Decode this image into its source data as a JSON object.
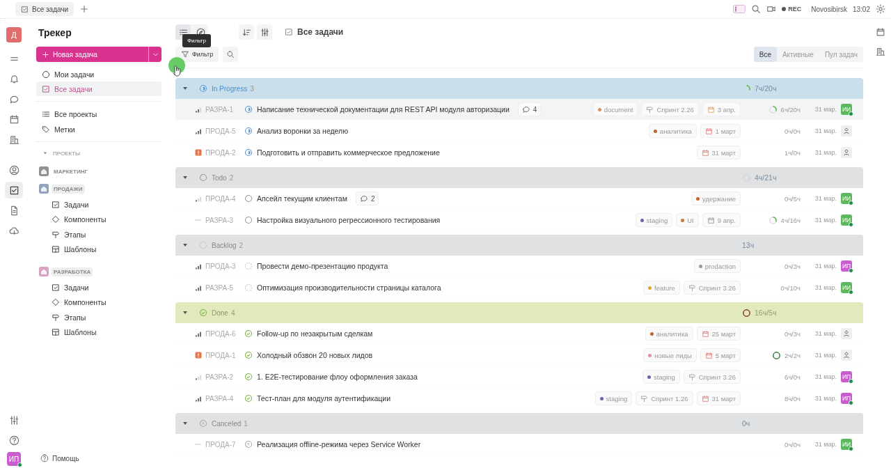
{
  "tab_bar": {
    "tabs": [
      {
        "label": "Все задачи",
        "selected": true
      }
    ],
    "rec": "REC",
    "city": "Novosibirsk",
    "time": "13:02"
  },
  "rail": {
    "logo": "Д",
    "items": [
      {
        "kind": "menu",
        "selected": false
      },
      {
        "kind": "bell",
        "selected": false
      },
      {
        "kind": "chat",
        "selected": false
      },
      {
        "kind": "calendar",
        "selected": false
      },
      {
        "kind": "building",
        "selected": false
      },
      {
        "kind": "user",
        "selected": false
      },
      {
        "kind": "tasks",
        "selected": true
      },
      {
        "kind": "document",
        "selected": false
      },
      {
        "kind": "cloud",
        "selected": false
      }
    ],
    "user": "ИП"
  },
  "sidebar": {
    "title": "Трекер",
    "new_button": "Новая задача",
    "nav": [
      {
        "label": "Мои задачи",
        "kind": "my",
        "selected": false
      },
      {
        "label": "Все задачи",
        "kind": "tasks",
        "selected": true
      }
    ],
    "links": [
      {
        "label": "Все проекты",
        "kind": "list"
      },
      {
        "label": "Метки",
        "kind": "tag"
      }
    ],
    "section": {
      "label": "ПРОЕКТЫ",
      "expanded": true
    },
    "projects": [
      {
        "name": "МАРКЕТИНГ",
        "color": "#8e9196",
        "expanded": false
      },
      {
        "name": "ПРОДАЖИ",
        "color": "#8fa3bd",
        "expanded": true,
        "children": [
          {
            "label": "Задачи",
            "kind": "tasks"
          },
          {
            "label": "Компоненты",
            "kind": "diamond"
          },
          {
            "label": "Этапы",
            "kind": "signpost"
          },
          {
            "label": "Шаблоны",
            "kind": "template"
          }
        ]
      },
      {
        "name": "РАЗРАБОТКА",
        "color": "#d7a3c4",
        "expanded": true,
        "children": [
          {
            "label": "Задачи",
            "kind": "tasks"
          },
          {
            "label": "Компоненты",
            "kind": "diamond"
          },
          {
            "label": "Этапы",
            "kind": "signpost"
          },
          {
            "label": "Шаблоны",
            "kind": "template"
          }
        ]
      }
    ],
    "help": "Помощь"
  },
  "toolbar": {
    "views": [
      {
        "kind": "list",
        "selected": true
      },
      {
        "kind": "compass",
        "selected": false
      }
    ],
    "tooltip": "Фильтр",
    "title": "Все задачи",
    "filter": "Фильтр",
    "segments": [
      {
        "label": "Все",
        "selected": true
      },
      {
        "label": "Активные",
        "selected": false
      },
      {
        "label": "Пул задач",
        "selected": false
      }
    ]
  },
  "groups": [
    {
      "name": "In Progress",
      "count": "3",
      "kind": "in_progress",
      "time": "7ч/20ч",
      "ring": {
        "kind": "partial"
      },
      "expanded": true,
      "tasks": [
        {
          "kind": "medium",
          "id": "РАЗРА-1",
          "title": "Написание технической документации для REST API модуля авторизации",
          "comments": "4",
          "tags": [
            {
              "label": "document",
              "color": "#d9925f"
            }
          ],
          "sprint": "Спринт 2.26",
          "due": {
            "text": "3 апр.",
            "kind": "soon"
          },
          "time": "6ч/20ч",
          "ring": {
            "kind": "partial"
          },
          "date": "31 мар.",
          "assignee": {
            "initials": "ИИ",
            "color": "#5cb85c"
          }
        },
        {
          "kind": "high",
          "id": "ПРОДА-5",
          "title": "Анализ воронки за неделю",
          "tags": [
            {
              "label": "аналитика",
              "color": "#b8682e"
            }
          ],
          "due": {
            "text": "1 март",
            "kind": "overdue"
          },
          "time": "0ч/0ч",
          "date": "31 мар."
        },
        {
          "kind": "urgent",
          "id": "ПРОДА-2",
          "title": "Подготовить и отправить коммерческое предложение",
          "due": {
            "text": "31 март",
            "kind": "overdue"
          },
          "time": "1ч/0ч",
          "date": "31 мар."
        }
      ]
    },
    {
      "name": "Todo",
      "count": "2",
      "kind": "todo",
      "time": "4ч/21ч",
      "ring": {
        "kind": "start"
      },
      "expanded": true,
      "tasks": [
        {
          "kind": "low",
          "id": "ПРОДА-4",
          "title": "Апсейл текущим клиентам",
          "comments": "2",
          "tags": [
            {
              "label": "удержание",
              "color": "#c2672c"
            }
          ],
          "time": "0ч/5ч",
          "date": "31 мар.",
          "assignee": {
            "initials": "ИИ",
            "color": "#5cb85c"
          }
        },
        {
          "kind": "none",
          "id": "РАЗРА-3",
          "title": "Настройка визуального регрессионного тестирования",
          "tags": [
            {
              "label": "staging",
              "color": "#6f63a8"
            },
            {
              "label": "UI",
              "color": "#cc7a3a"
            }
          ],
          "due": {
            "text": "9 апр.",
            "kind": "normal"
          },
          "time": "4ч/16ч",
          "ring": {
            "kind": "partial"
          },
          "date": "31 мар.",
          "assignee": {
            "initials": "ИИ",
            "color": "#5cb85c"
          }
        }
      ]
    },
    {
      "name": "Backlog",
      "count": "2",
      "kind": "backlog",
      "time": "13ч",
      "expanded": true,
      "tasks": [
        {
          "kind": "high",
          "id": "ПРОДА-3",
          "title": "Провести демо-презентацию продукта",
          "tags": [
            {
              "label": "prodaction",
              "color": "#9a9a9a"
            }
          ],
          "time": "0ч/3ч",
          "date": "31 мар.",
          "assignee": {
            "initials": "ИП",
            "color": "#c95ccf"
          }
        },
        {
          "kind": "high",
          "id": "РАЗРА-5",
          "title": "Оптимизация производительности страницы каталога",
          "tags": [
            {
              "label": "feature",
              "color": "#e3a634"
            }
          ],
          "sprint": "Спринт 3.26",
          "time": "0ч/10ч",
          "date": "31 мар.",
          "assignee": {
            "initials": "ИИ",
            "color": "#5cb85c"
          }
        }
      ]
    },
    {
      "name": "Done",
      "count": "4",
      "kind": "done",
      "time": "16ч/5ч",
      "ring": {
        "kind": "over"
      },
      "expanded": true,
      "tasks": [
        {
          "kind": "high",
          "id": "ПРОДА-6",
          "title": "Follow-up по незакрытым сделкам",
          "tags": [
            {
              "label": "аналитика",
              "color": "#b8682e"
            }
          ],
          "due": {
            "text": "25 март",
            "kind": "overdue"
          },
          "time": "0ч/3ч",
          "date": "31 мар."
        },
        {
          "kind": "urgent",
          "id": "ПРОДА-1",
          "title": "Холодный обзвон 20 новых лидов",
          "tags": [
            {
              "label": "новые лиды",
              "color": "#e58fa0"
            }
          ],
          "due": {
            "text": "5 март",
            "kind": "overdue"
          },
          "time": "2ч/2ч",
          "ring": {
            "kind": "full"
          },
          "date": "31 мар."
        },
        {
          "kind": "low",
          "id": "РАЗРА-2",
          "title": "1. E2E-тестирование флоу оформления заказа",
          "tags": [
            {
              "label": "staging",
              "color": "#6f63a8"
            }
          ],
          "sprint": "Спринт 3.26",
          "time": "6ч/0ч",
          "date": "31 мар.",
          "assignee": {
            "initials": "ИП",
            "color": "#c95ccf"
          }
        },
        {
          "kind": "high",
          "id": "РАЗРА-4",
          "title": "Тест-план для модуля аутентификации",
          "tags": [
            {
              "label": "staging",
              "color": "#6f63a8"
            }
          ],
          "sprint": "Спринт 1.26",
          "due": {
            "text": "31 март",
            "kind": "overdue"
          },
          "time": "8ч/0ч",
          "date": "31 мар.",
          "assignee": {
            "initials": "ИП",
            "color": "#c95ccf"
          }
        }
      ]
    },
    {
      "name": "Canceled",
      "count": "1",
      "kind": "canceled",
      "time": "0ч",
      "expanded": true,
      "tasks": [
        {
          "kind": "none",
          "id": "ПРОДА-7",
          "title": "Реализация offline-режима через Service Worker",
          "time": "0ч/0ч",
          "date": "31 мар.",
          "assignee": {
            "initials": "ИИ",
            "color": "#5cb85c"
          }
        }
      ]
    }
  ]
}
